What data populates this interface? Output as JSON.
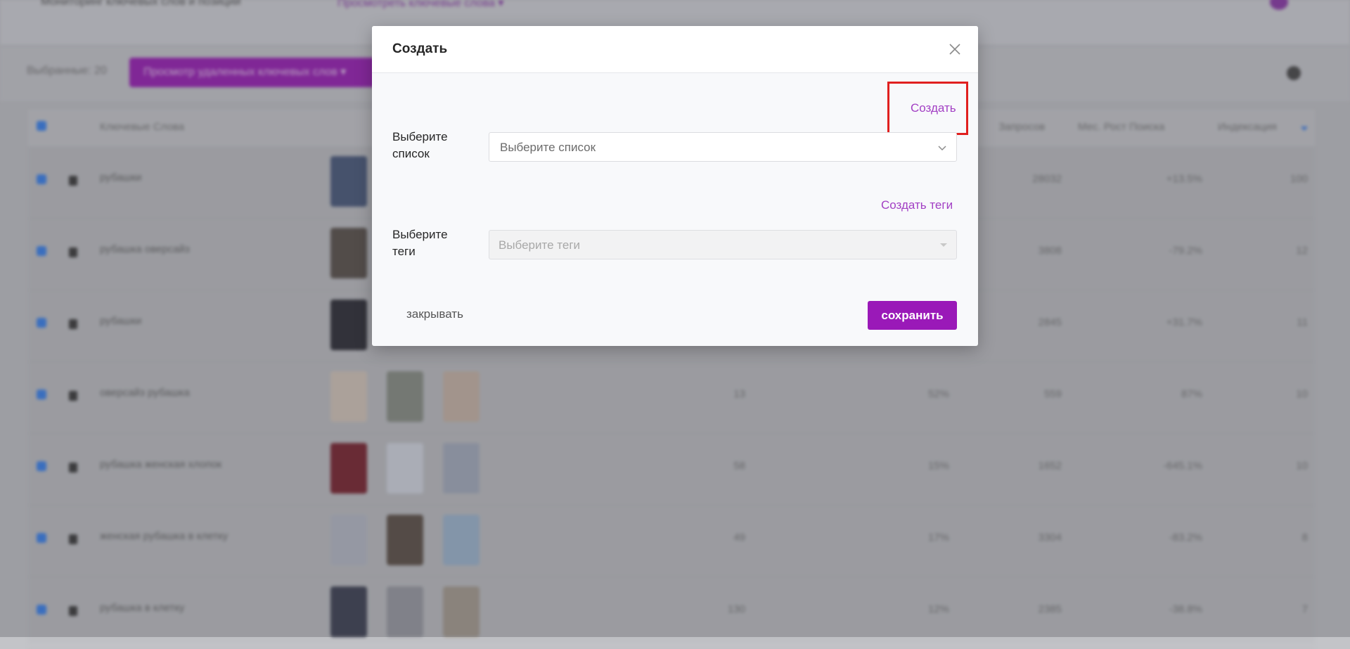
{
  "background": {
    "top_bar": {
      "crumb": "Мониторинг ключевых слов и позиций",
      "crumb_link": "Просмотреть ключевые слова ▾"
    },
    "toolbar": {
      "selected_label": "Выбранные: 20",
      "action_button": "Просмотр удаленных ключевых слов ▾"
    },
    "table": {
      "headers": [
        "Ключевые Слова",
        "Запросов",
        "Мес. Рост Поиска",
        "Индексация"
      ],
      "rows": [
        {
          "keyword": "рубашки",
          "c1": "",
          "c2": "",
          "c3": "28032",
          "c4": "+13.5%",
          "c5": "100"
        },
        {
          "keyword": "рубашка оверсайз",
          "c1": "",
          "c2": "",
          "c3": "3808",
          "c4": "-79.2%",
          "c5": "12"
        },
        {
          "keyword": "рубашки",
          "c1": "",
          "c2": "",
          "c3": "2845",
          "c4": "+31.7%",
          "c5": "11"
        },
        {
          "keyword": "оверсайз рубашка",
          "c1": "13",
          "c2": "52%",
          "c3": "559",
          "c4": "87%",
          "c5": "10"
        },
        {
          "keyword": "рубашка женская хлопок",
          "c1": "58",
          "c2": "15%",
          "c3": "1652",
          "c4": "-645.1%",
          "c5": "10"
        },
        {
          "keyword": "женская рубашка в клетку",
          "c1": "49",
          "c2": "17%",
          "c3": "3304",
          "c4": "-83.2%",
          "c5": "8"
        },
        {
          "keyword": "рубашка в клетку",
          "c1": "130",
          "c2": "12%",
          "c3": "2385",
          "c4": "-38.8%",
          "c5": "7"
        }
      ]
    }
  },
  "modal": {
    "title": "Создать",
    "create_link": "Создать",
    "list_label": "Выберите список",
    "list_placeholder": "Выберите список",
    "create_tags_link": "Создать теги",
    "tags_label": "Выберите теги",
    "tags_placeholder": "Выберите теги",
    "close_button": "закрывать",
    "save_button": "сохранить"
  },
  "colors": {
    "accent": "#9a19b8",
    "link": "#a23fc4",
    "highlight": "#e0201f"
  }
}
